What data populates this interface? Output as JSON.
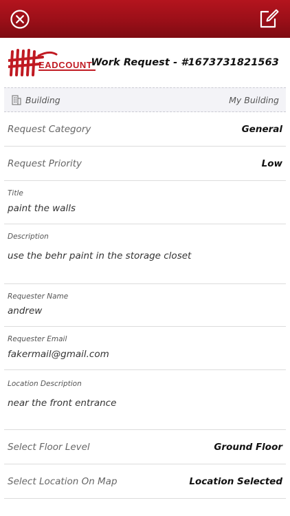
{
  "toolbar": {
    "close_icon": "close-circle-icon",
    "edit_icon": "edit-pencil-icon",
    "bar_color": "#9a0f18"
  },
  "header": {
    "logo_text": "HEADCOUNT",
    "title": "Work Request - #1673731821563"
  },
  "building": {
    "icon": "building-icon",
    "label": "Building",
    "value": "My Building"
  },
  "fields": {
    "category": {
      "label": "Request Category",
      "value": "General"
    },
    "priority": {
      "label": "Request Priority",
      "value": "Low"
    },
    "title": {
      "label": "Title",
      "value": "paint the walls"
    },
    "description": {
      "label": "Description",
      "value": "use the behr paint in the storage closet"
    },
    "requester_name": {
      "label": "Requester Name",
      "value": "andrew"
    },
    "requester_email": {
      "label": "Requester Email",
      "value": "fakermail@gmail.com"
    },
    "location_description": {
      "label": "Location Description",
      "value": "near the front entrance"
    },
    "floor_level": {
      "label": "Select Floor Level",
      "value": "Ground Floor"
    },
    "location_map": {
      "label": "Select Location On Map",
      "value": "Location Selected"
    }
  }
}
